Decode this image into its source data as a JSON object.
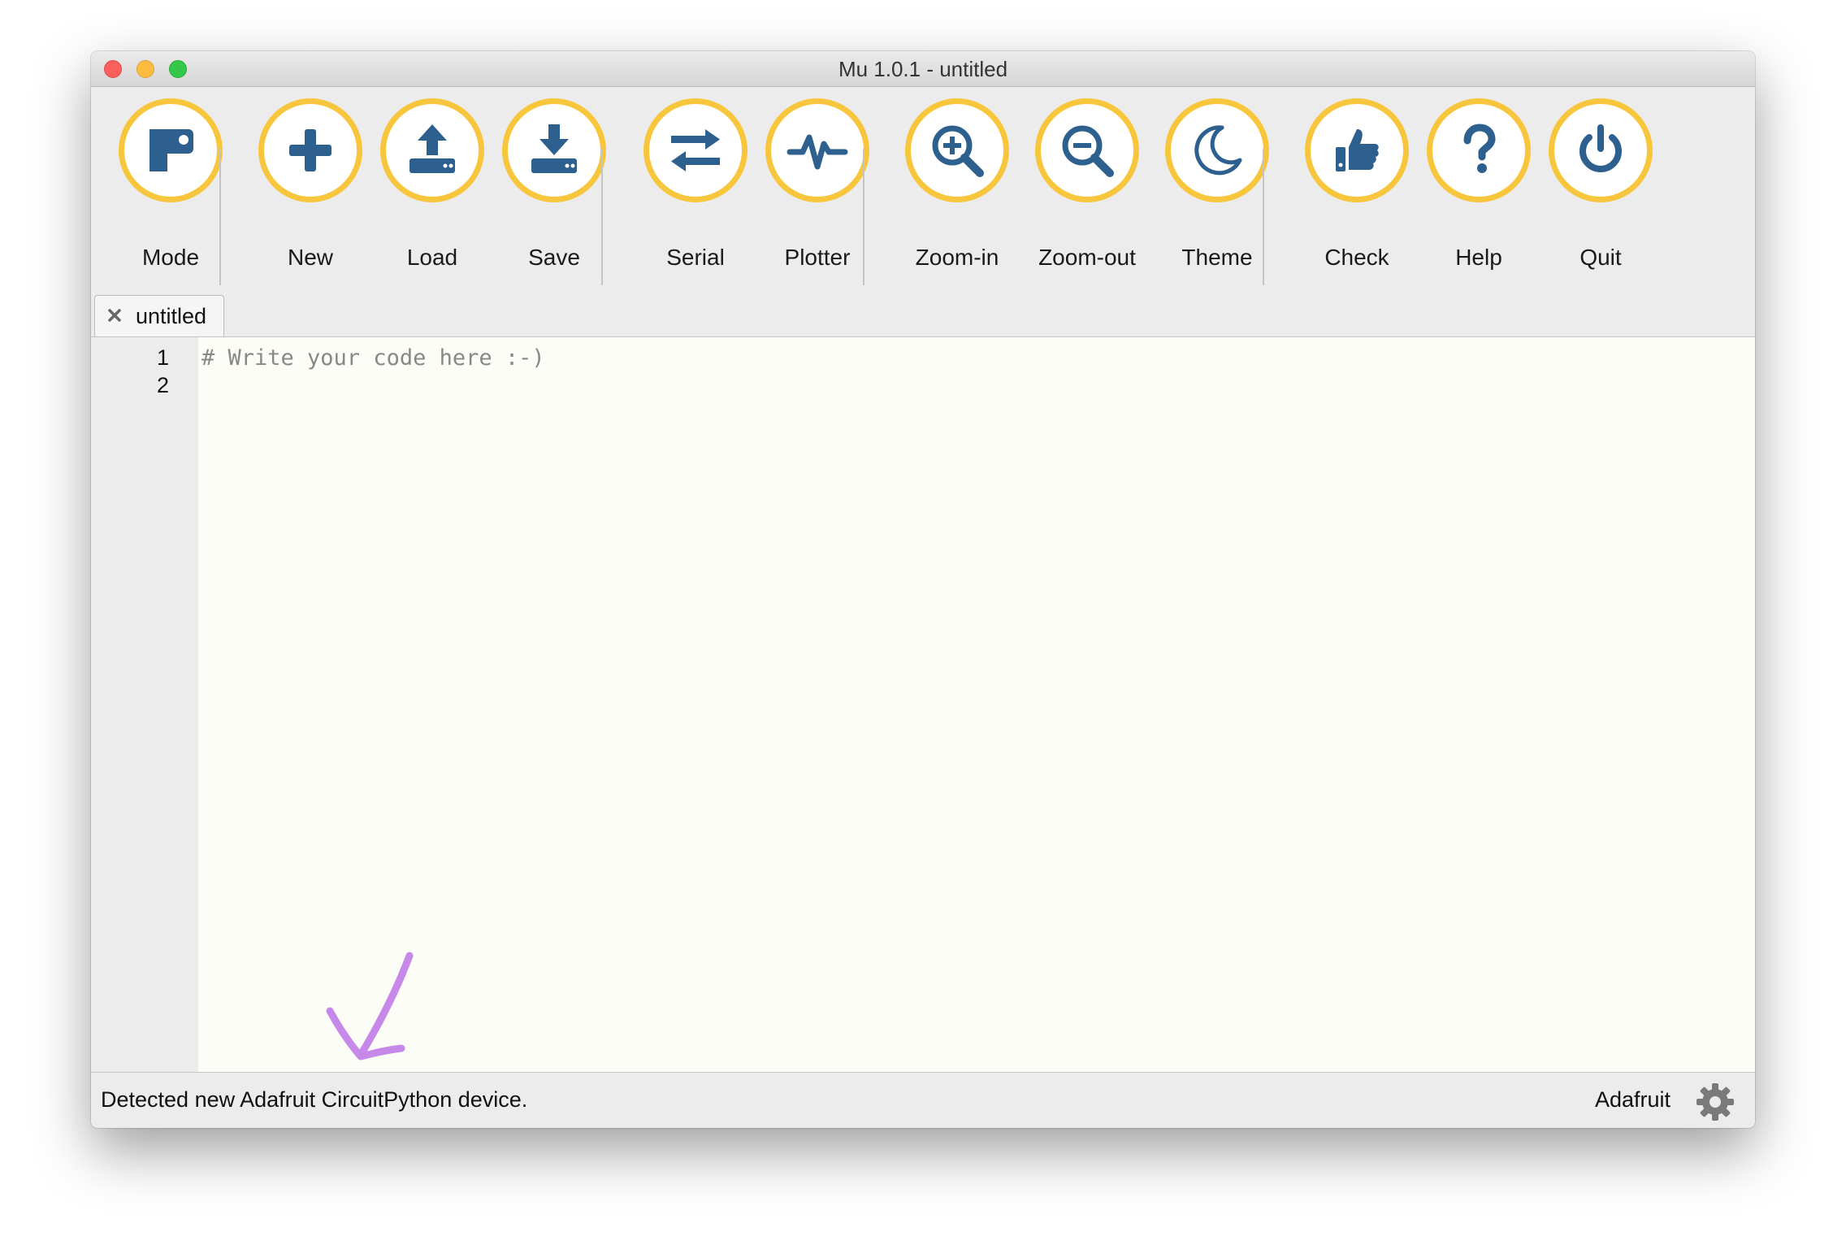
{
  "window": {
    "title": "Mu 1.0.1 - untitled"
  },
  "toolbar": {
    "buttons": [
      {
        "label": "Mode",
        "icon": "mode-icon"
      },
      {
        "label": "New",
        "icon": "plus-icon"
      },
      {
        "label": "Load",
        "icon": "upload-icon"
      },
      {
        "label": "Save",
        "icon": "download-icon"
      },
      {
        "label": "Serial",
        "icon": "swap-arrows-icon"
      },
      {
        "label": "Plotter",
        "icon": "pulse-icon"
      },
      {
        "label": "Zoom-in",
        "icon": "zoom-in-icon"
      },
      {
        "label": "Zoom-out",
        "icon": "zoom-out-icon"
      },
      {
        "label": "Theme",
        "icon": "moon-icon"
      },
      {
        "label": "Check",
        "icon": "thumbs-up-icon"
      },
      {
        "label": "Help",
        "icon": "question-icon"
      },
      {
        "label": "Quit",
        "icon": "power-icon"
      }
    ]
  },
  "tabs": [
    {
      "label": "untitled",
      "close_icon": "close-icon"
    }
  ],
  "editor": {
    "line_numbers": [
      "1",
      "2"
    ],
    "lines": [
      "# Write your code here :-)",
      ""
    ]
  },
  "status": {
    "message": "Detected new Adafruit CircuitPython device.",
    "mode": "Adafruit",
    "settings_icon": "gear-icon"
  },
  "colors": {
    "ring": "#f8c63c",
    "icon": "#2d5f8f",
    "editor_bg": "#fdfdf7",
    "annotation_arrow": "#c27de8"
  }
}
